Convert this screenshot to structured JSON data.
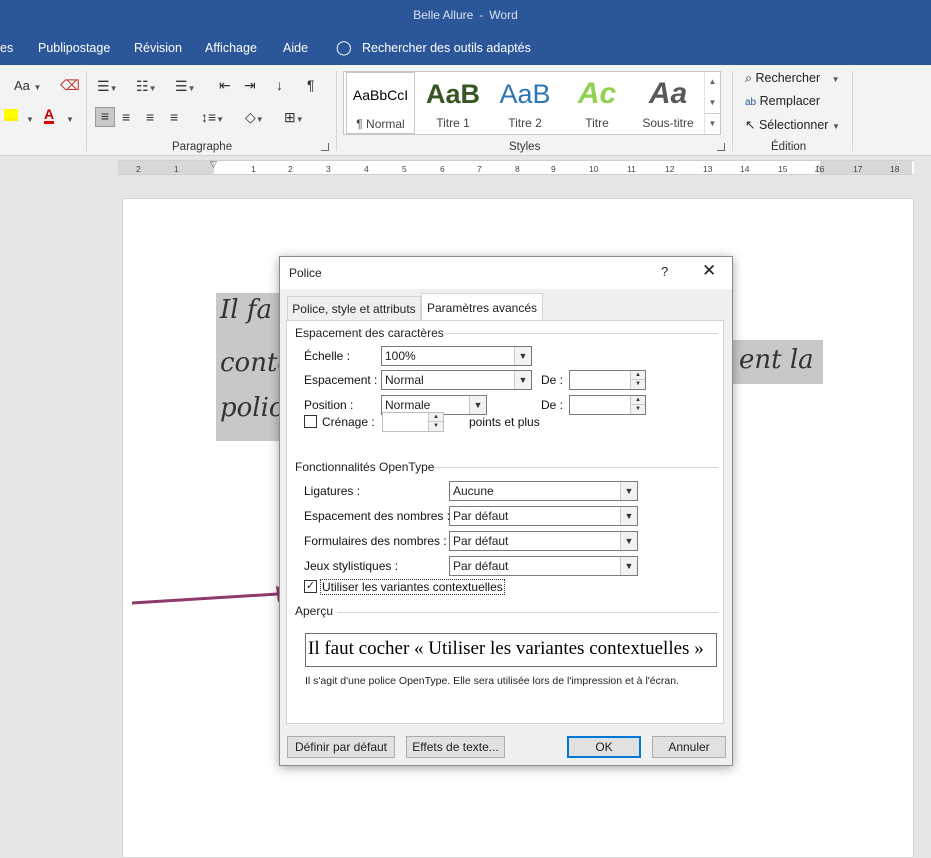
{
  "window": {
    "doc_name": "Belle Allure",
    "separator": "-",
    "app_name": "Word"
  },
  "ribbon_tabs": [
    "es",
    "Publipostage",
    "Révision",
    "Affichage",
    "Aide"
  ],
  "tell_me": "Rechercher des outils adaptés",
  "groups": {
    "paragraph": "Paragraphe",
    "styles": "Styles",
    "editing": "Édition"
  },
  "font_group": {
    "change_case": "Aa"
  },
  "styles": [
    {
      "sample": "AaBbCcI",
      "name": "¶ Normal",
      "color": "#000000"
    },
    {
      "sample": "AaB",
      "name": "Titre 1",
      "color": "#375623"
    },
    {
      "sample": "AaB",
      "name": "Titre 2",
      "color": "#2e75b6"
    },
    {
      "sample": "Ac",
      "name": "Titre",
      "color": "#92d050"
    },
    {
      "sample": "Aa",
      "name": "Sous-titre",
      "color": "#595959"
    }
  ],
  "editing": {
    "find": "Rechercher",
    "replace": "Remplacer",
    "select": "Sélectionner"
  },
  "ruler": {
    "labels": [
      "2",
      "1",
      "1",
      "2",
      "3",
      "4",
      "5",
      "6",
      "7",
      "8",
      "9",
      "10",
      "11",
      "12",
      "13",
      "14",
      "15",
      "16",
      "17",
      "18"
    ]
  },
  "document": {
    "line1_start": "Il fa",
    "line2_start": "contex",
    "line2_end": "ent la",
    "line3_start": "polic"
  },
  "dialog": {
    "title": "Police",
    "help": "?",
    "close": "✕",
    "tabs": [
      "Police, style et attributs",
      "Paramètres avancés"
    ],
    "char_spacing": {
      "title": "Espacement des caractères",
      "scale_label": "Échelle :",
      "scale_value": "100%",
      "spacing_label": "Espacement :",
      "spacing_value": "Normal",
      "position_label": "Position :",
      "position_value": "Normale",
      "by_label": "De :",
      "kerning_label": "Crénage :",
      "kerning_unit": "points et plus"
    },
    "opentype": {
      "title": "Fonctionnalités OpenType",
      "ligatures_label": "Ligatures :",
      "ligatures_value": "Aucune",
      "num_spacing_label": "Espacement des nombres :",
      "num_spacing_value": "Par défaut",
      "num_forms_label": "Formulaires des nombres :",
      "num_forms_value": "Par défaut",
      "stylistic_label": "Jeux stylistiques :",
      "stylistic_value": "Par défaut",
      "contextual_label": "Utiliser les variantes contextuelles",
      "contextual_checked": true
    },
    "preview": {
      "title": "Aperçu",
      "text": "Il faut cocher « Utiliser les variantes contextuelles »",
      "note": "Il s'agit d'une police OpenType. Elle sera utilisée lors de l'impression et à l'écran."
    },
    "buttons": {
      "set_default": "Définir par défaut",
      "text_effects": "Effets de texte...",
      "ok": "OK",
      "cancel": "Annuler"
    }
  },
  "colors": {
    "accent": "#2b579a",
    "arrow": "#8e3a6d",
    "selection": "#c8c8c8"
  }
}
